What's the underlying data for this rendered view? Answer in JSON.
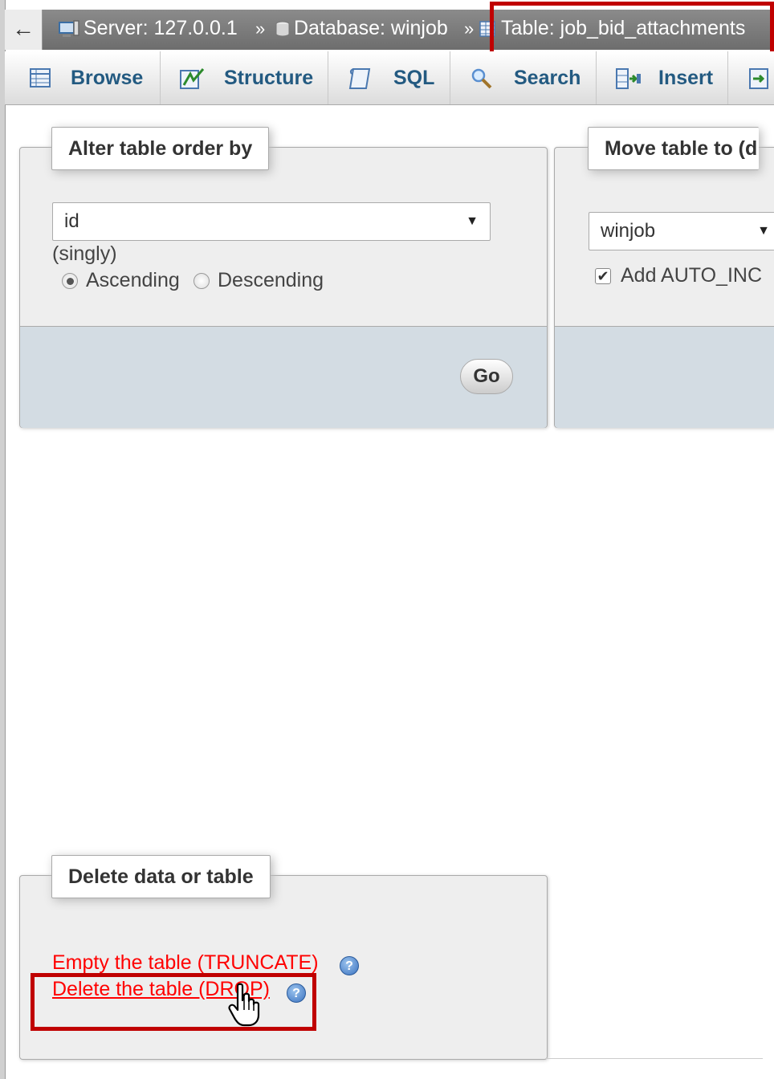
{
  "breadcrumb": {
    "back_glyph": "←",
    "server": "Server: 127.0.0.1",
    "database": "Database: winjob",
    "table": "Table: job_bid_attachments",
    "separator": "»"
  },
  "tabs": [
    {
      "label": "Browse",
      "icon": "browse-icon"
    },
    {
      "label": "Structure",
      "icon": "structure-icon"
    },
    {
      "label": "SQL",
      "icon": "sql-icon"
    },
    {
      "label": "Search",
      "icon": "search-icon"
    },
    {
      "label": "Insert",
      "icon": "insert-icon"
    },
    {
      "label": "",
      "icon": "export-icon"
    }
  ],
  "alter_order": {
    "legend": "Alter table order by",
    "selected_column": "id",
    "note": "(singly)",
    "ascending_label": "Ascending",
    "descending_label": "Descending",
    "selected_order": "Ascending",
    "go_label": "Go"
  },
  "move_table": {
    "legend": "Move table to (d",
    "selected_database": "winjob",
    "auto_increment_label": "Add AUTO_INC",
    "auto_increment_checked": true
  },
  "delete_section": {
    "legend": "Delete data or table",
    "truncate_label": "Empty the table (TRUNCATE)",
    "drop_label": "Delete the table (DROP)",
    "help_glyph": "?"
  },
  "colors": {
    "highlight": "#c00000",
    "link_red": "#ff0000",
    "tab_text": "#235a81",
    "footer_bg": "#d3dce3"
  }
}
